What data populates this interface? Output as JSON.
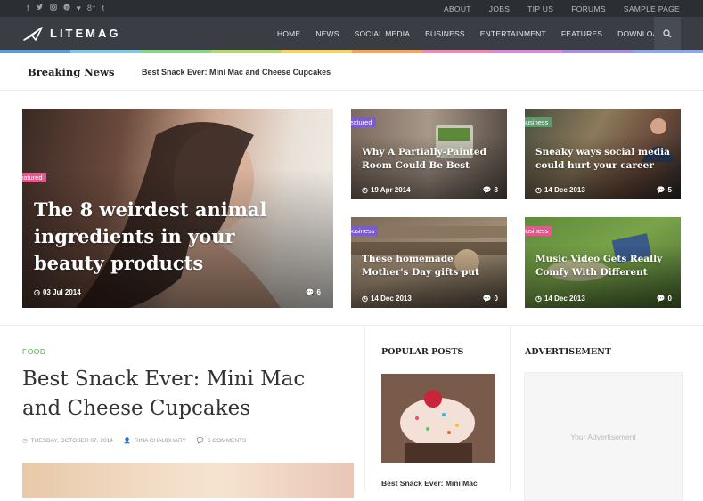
{
  "topbar": {
    "social_icons": [
      "facebook-icon",
      "twitter-icon",
      "instagram-icon",
      "pinterest-icon",
      "heart-icon",
      "googleplus-icon",
      "tumblr-icon"
    ],
    "social_glyphs": [
      "f",
      "🐦",
      "◙",
      "℗",
      "♥",
      "8⁺",
      "t"
    ],
    "links": [
      "ABOUT",
      "JOBS",
      "TIP US",
      "FORUMS",
      "SAMPLE PAGE"
    ]
  },
  "header": {
    "logo": "LITEMAG",
    "nav": [
      "HOME",
      "NEWS",
      "SOCIAL MEDIA",
      "BUSINESS",
      "ENTERTAINMENT",
      "FEATURES",
      "DOWNLOAD"
    ],
    "rainbow_colors": [
      "#5a9bd5",
      "#7ec8e3",
      "#8ad48a",
      "#b5d96a",
      "#f4d35e",
      "#f7a35c",
      "#f08ab0",
      "#d88ad8",
      "#a98ee0",
      "#8fa6e8"
    ]
  },
  "breaking": {
    "label": "Breaking News",
    "headline": "Best Snack Ever: Mini Mac and Cheese Cupcakes"
  },
  "featured": [
    {
      "badge": "featured",
      "badge_color": "#e05a8a",
      "title": "The 8 weirdest animal ingredients in your beauty products",
      "date": "03 Jul 2014",
      "comments": "6"
    },
    {
      "badge": "featured",
      "badge_color": "#7b5cc9",
      "title": "Why A Partially-Painted Room Could Be Best",
      "date": "19 Apr 2014",
      "comments": "8"
    },
    {
      "badge": "Business",
      "badge_color": "#5e9a6e",
      "title": "Sneaky ways social media could hurt your career",
      "date": "14 Dec 2013",
      "comments": "5"
    },
    {
      "badge": "Business",
      "badge_color": "#7b5cc9",
      "title": "These homemade Mother's Day gifts put that bottle",
      "date": "14 Dec 2013",
      "comments": "0"
    },
    {
      "badge": "Business",
      "badge_color": "#e05a8a",
      "title": "Music Video Gets Really Comfy With Different Sizes",
      "date": "14 Dec 2013",
      "comments": "0"
    }
  ],
  "article": {
    "category": "FOOD",
    "title": "Best Snack Ever: Mini Mac and Cheese Cupcakes",
    "date": "TUESDAY, OCTOBER 07, 2014",
    "author": "RINA CHAUDHARY",
    "comments": "6 COMMENTS"
  },
  "popular": {
    "heading": "POPULAR POSTS",
    "title": "Best Snack Ever: Mini Mac"
  },
  "advert": {
    "heading": "ADVERTISEMENT",
    "placeholder": "Your Advertisement"
  }
}
